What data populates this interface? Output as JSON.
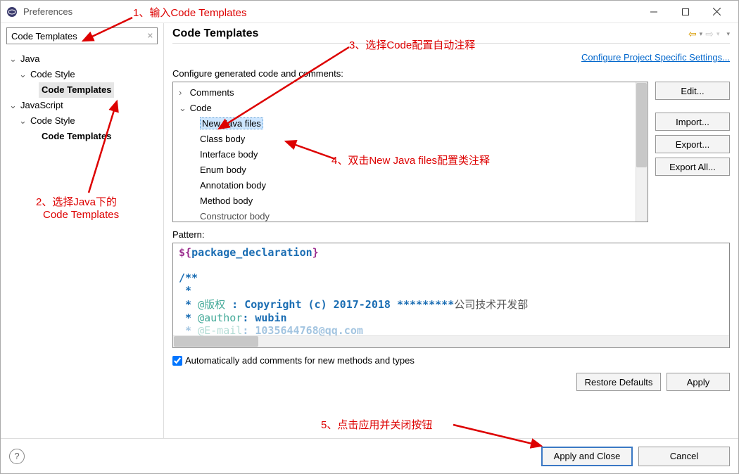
{
  "window": {
    "title": "Preferences"
  },
  "filter": {
    "value": "Code Templates"
  },
  "leftTree": {
    "n0": {
      "label": "Java"
    },
    "n1": {
      "label": "Code Style"
    },
    "n2": {
      "label": "Code Templates"
    },
    "n3": {
      "label": "JavaScript"
    },
    "n4": {
      "label": "Code Style"
    },
    "n5": {
      "label": "Code Templates"
    }
  },
  "page": {
    "title": "Code Templates",
    "projectLink": "Configure Project Specific Settings...",
    "configLabel": "Configure generated code and comments:",
    "patternLabel": "Pattern:",
    "checkboxLabel": "Automatically add comments for new methods and types"
  },
  "codeTree": {
    "r0": "Comments",
    "r1": "Code",
    "r2": "New Java files",
    "r3": "Class body",
    "r4": "Interface body",
    "r5": "Enum body",
    "r6": "Annotation body",
    "r7": "Method body",
    "r8": "Constructor body"
  },
  "buttons": {
    "edit": "Edit...",
    "import": "Import...",
    "export": "Export...",
    "exportAll": "Export All...",
    "restore": "Restore Defaults",
    "apply": "Apply",
    "applyClose": "Apply and Close",
    "cancel": "Cancel"
  },
  "pattern": {
    "line1a": "${",
    "line1b": "package_declaration",
    "line1c": "}",
    "line2": "",
    "line3": "/**",
    "line4": " *  ",
    "line5a": " * ",
    "line5b": "@版权",
    "line5c": " : Copyright (c) 2017-2018 *********",
    "line5d": "公司技术开发部",
    "line6a": " * ",
    "line6b": "@author",
    "line6c": ": wubin",
    "line7a": " * ",
    "line7b": "@E-mail",
    "line7c": ": 1035644768@qq.com"
  },
  "annotations": {
    "a1": "1、输入Code Templates",
    "a2a": "2、选择Java下的",
    "a2b": "Code Templates",
    "a3": "3、选择Code配置自动注释",
    "a4": "4、双击New Java files配置类注释",
    "a5": "5、点击应用并关闭按钮"
  }
}
